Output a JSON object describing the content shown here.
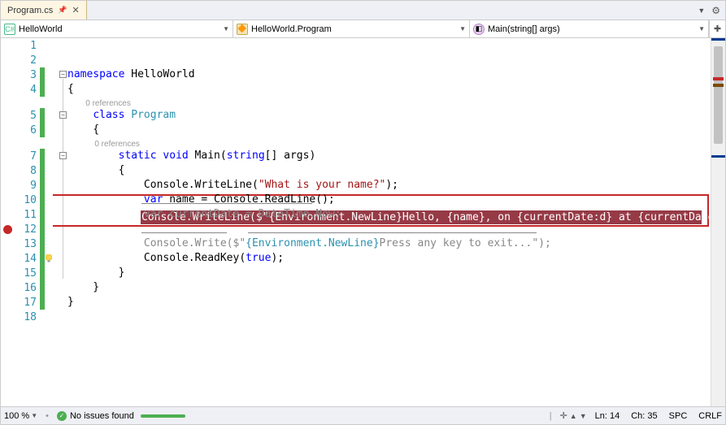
{
  "tab": {
    "filename": "Program.cs"
  },
  "nav": {
    "namespace": "HelloWorld",
    "class": "HelloWorld.Program",
    "method": "Main(string[] args)"
  },
  "references": {
    "label": "0 references"
  },
  "code": {
    "line3_ns": "namespace",
    "line3_name": " HelloWorld",
    "line5_class": "class",
    "line5_name": " Program",
    "line7_static": "static",
    "line7_void": " void",
    "line7_main": " Main(",
    "line7_string": "string",
    "line7_args": "[] args)",
    "line9_console": "Console",
    "line9_rest": ".WriteLine(",
    "line9_str": "\"What is your name?\"",
    "line9_end": ");",
    "line10_var": "var",
    "line10_rest": " name = Console.ReadLine();",
    "line11_var": "var",
    "line11_rest": " currentDate = DateTime.Now;",
    "line12": "Console.WriteLine($\"{Environment.NewLine}Hello, {name}, on {currentDate:d} at {currentDate:t}!\");",
    "line13_a": "Console.Write(",
    "line13_b": "$\"",
    "line13_c": "{Environment.NewLine}",
    "line13_d": "Press any key to exit...\"",
    "line13_e": ");",
    "line14_a": "Console.ReadKey(",
    "line14_true": "true",
    "line14_b": ");"
  },
  "status": {
    "zoom": "100 %",
    "issues": "No issues found",
    "line": "Ln: 14",
    "char": "Ch: 35",
    "spc": "SPC",
    "crlf": "CRLF"
  }
}
